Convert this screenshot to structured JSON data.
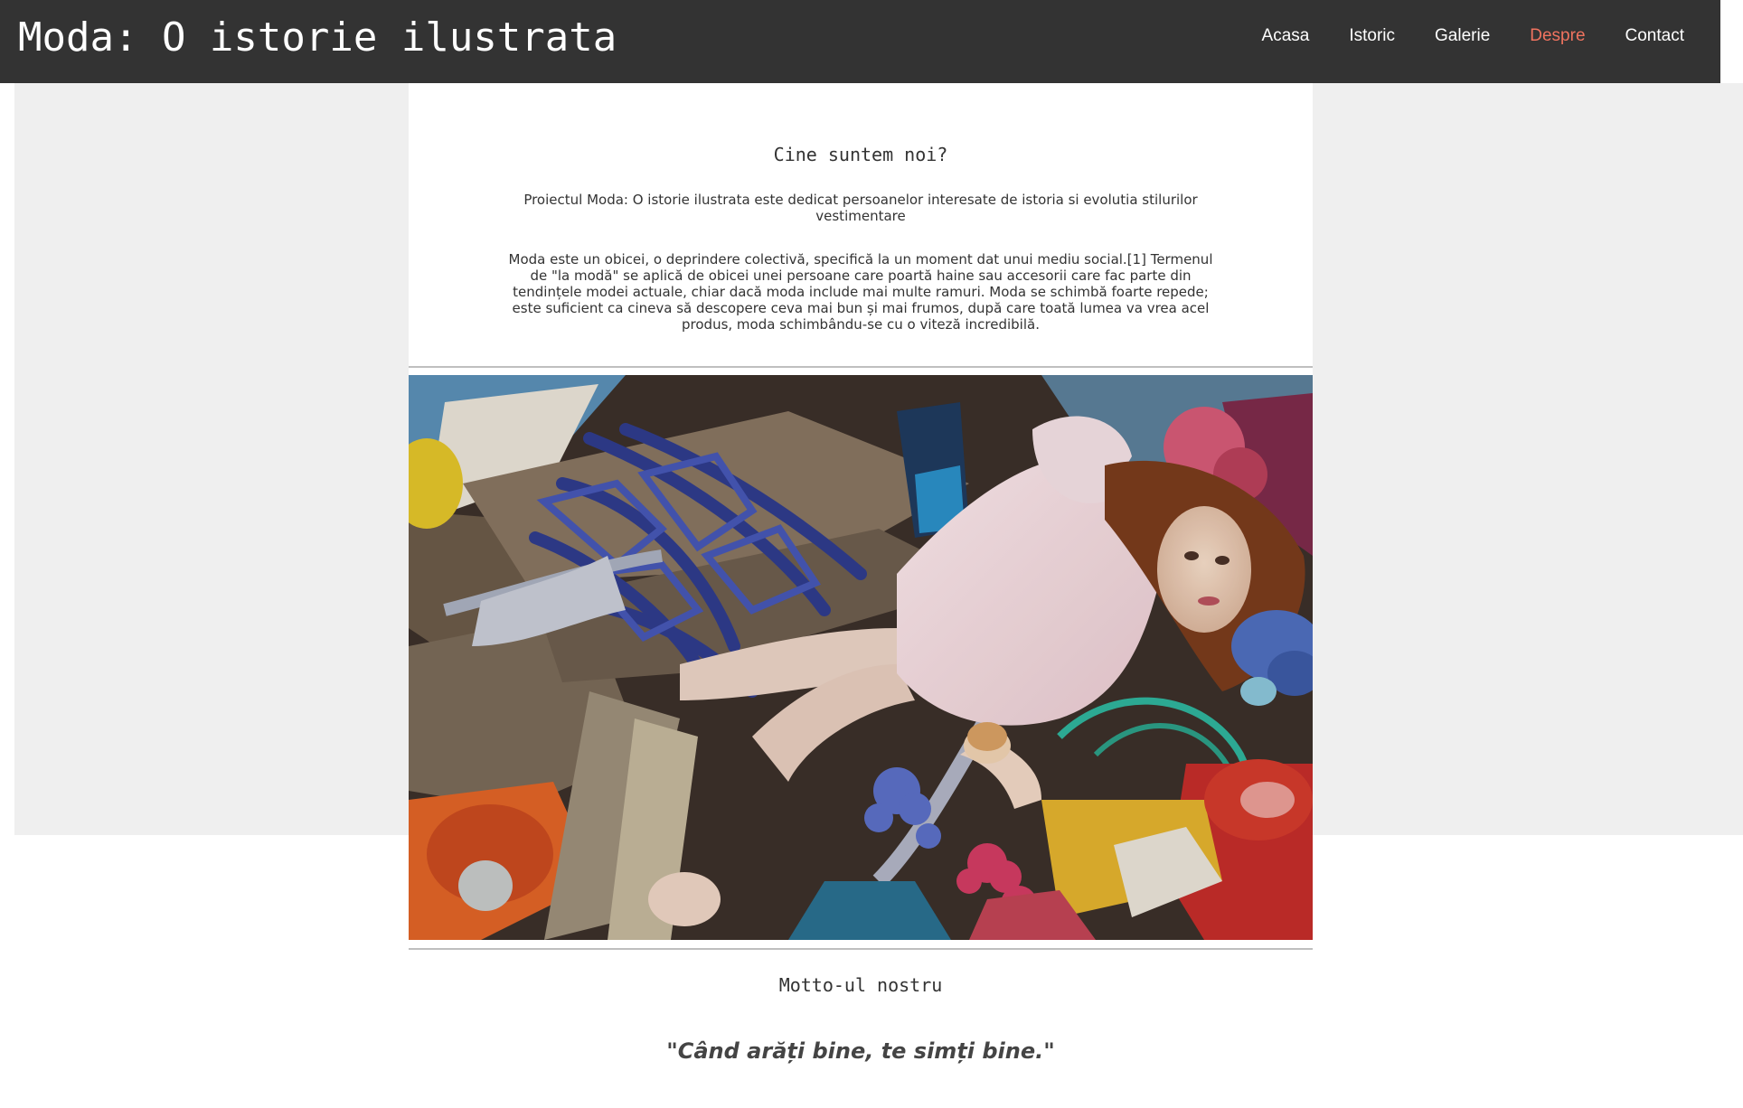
{
  "site": {
    "title": "Moda: O istorie ilustrata"
  },
  "nav": {
    "items": [
      {
        "label": "Acasa",
        "active": false
      },
      {
        "label": "Istoric",
        "active": false
      },
      {
        "label": "Galerie",
        "active": false
      },
      {
        "label": "Despre",
        "active": true
      },
      {
        "label": "Contact",
        "active": false
      }
    ]
  },
  "about": {
    "title": "Cine suntem noi?",
    "intro": "Proiectul Moda: O istorie ilustrata este dedicat persoanelor interesate de istoria si evolutia stilurilor vestimentare",
    "definition": "Moda este un obicei, o deprindere colectivă, specifică la un moment dat unui mediu social.[1] Termenul de \"la modă\" se aplică de obicei unei persoane care poartă haine sau accesorii care fac parte din tendințele modei actuale, chiar dacă moda include mai multe ramuri. Moda se schimbă foarte repede; este suficient ca cineva să descopere ceva mai bun și mai frumos, după care toată lumea va vrea acel produs, moda schimbându-se cu o viteză incredibilă."
  },
  "motto": {
    "title": "Motto-ul nostru",
    "quote": "\"Când arăți bine, te simți bine.\""
  },
  "colors": {
    "navbar_bg": "#333333",
    "nav_active": "#f0735f",
    "page_bg": "#efefef",
    "content_bg": "#ffffff",
    "text": "#333333"
  }
}
